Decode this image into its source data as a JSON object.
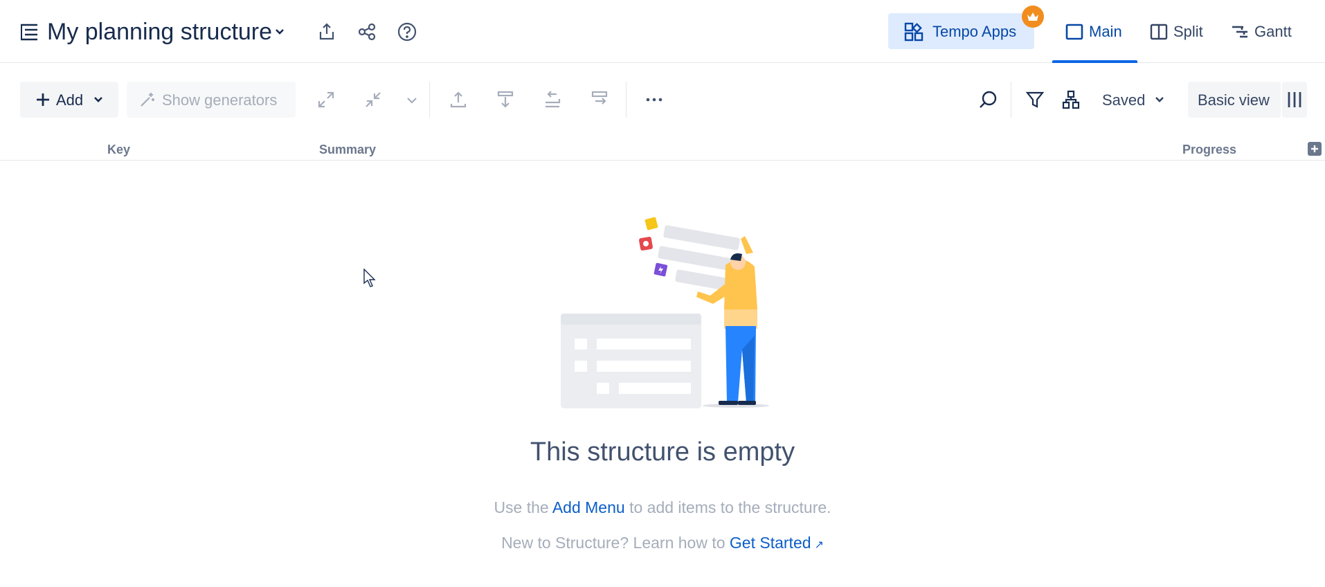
{
  "header": {
    "title": "My planning structure",
    "apps_button_label": "Tempo Apps",
    "view_tabs": [
      {
        "label": "Main",
        "icon": "window-icon",
        "active": true
      },
      {
        "label": "Split",
        "icon": "split-icon",
        "active": false
      },
      {
        "label": "Gantt",
        "icon": "gantt-icon",
        "active": false
      }
    ],
    "icons": [
      "structure-icon",
      "chevron-down-icon",
      "export-icon",
      "share-icon",
      "help-icon",
      "crown-icon"
    ]
  },
  "toolbar": {
    "add_label": "Add",
    "generators_label": "Show generators",
    "saved_label": "Saved",
    "basic_view_label": "Basic view",
    "icons": [
      "expand-icon",
      "collapse-icon",
      "move-up-icon",
      "move-down-icon",
      "outdent-icon",
      "indent-icon",
      "more-icon",
      "search-icon",
      "filter-icon",
      "hierarchy-icon",
      "columns-icon"
    ]
  },
  "columns": {
    "key": "Key",
    "summary": "Summary",
    "progress": "Progress"
  },
  "empty_state": {
    "title": "This structure is empty",
    "line1_before": "Use the ",
    "line1_link": "Add Menu",
    "line1_after": " to add items to the structure.",
    "line2_before": "New to Structure? Learn how to ",
    "line2_link": "Get Started",
    "line2_link_icon": "↗"
  },
  "colors": {
    "accent": "#0c66e4",
    "link": "#0c5ec9",
    "apps_bg": "#deebff",
    "badge": "#f18d1f",
    "text": "#172b4d",
    "muted": "#a5adba"
  }
}
